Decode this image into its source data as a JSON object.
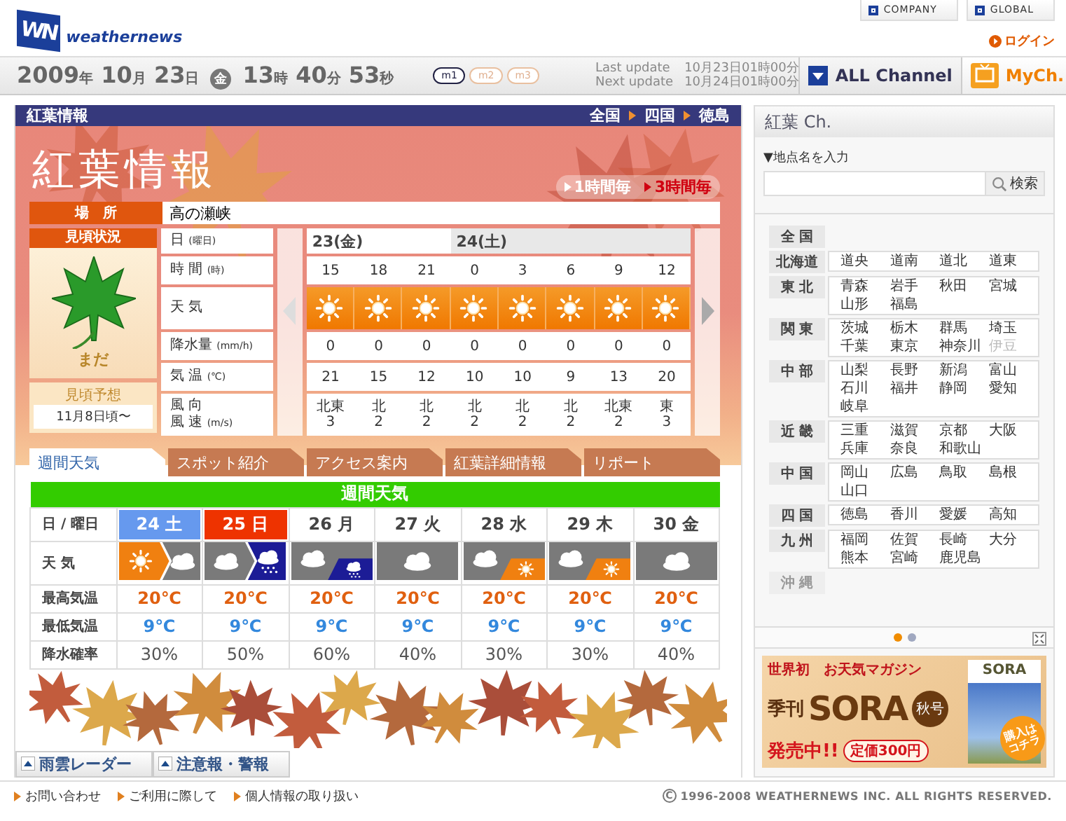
{
  "header": {
    "logo_mark": "WN",
    "logo": "weathernews",
    "links": [
      "COMPANY",
      "GLOBAL"
    ],
    "login": "ログイン"
  },
  "datebar": {
    "date": [
      {
        "value": "2009",
        "unit": "年"
      },
      {
        "value": "10",
        "unit": "月"
      },
      {
        "value": "23",
        "unit": "日"
      }
    ],
    "weekday": "金",
    "time": [
      {
        "value": "13",
        "unit": "時"
      },
      {
        "value": "40",
        "unit": "分"
      },
      {
        "value": "53",
        "unit": "秒"
      }
    ],
    "modes": [
      {
        "label": "m1",
        "selected": true
      },
      {
        "label": "m2",
        "selected": false
      },
      {
        "label": "m3",
        "selected": false
      }
    ],
    "updates": [
      {
        "label": "Last update",
        "value": "10月23日01時00分"
      },
      {
        "label": "Next update",
        "value": "10月24日01時00分"
      }
    ],
    "channels": [
      {
        "label": "ALL Channel",
        "kind": "all"
      },
      {
        "label": "MyCh.",
        "kind": "my"
      }
    ]
  },
  "panel": {
    "title": "紅葉情報",
    "breadcrumb": [
      "全国",
      "四国",
      "徳島"
    ],
    "heading": "紅葉情報",
    "intervals": [
      {
        "label": "1時間毎",
        "selected": false
      },
      {
        "label": "3時間毎",
        "selected": true
      }
    ],
    "place_label": "場　所",
    "place": "高の瀬峡",
    "status_label": "見頃状況",
    "status": "まだ",
    "forecast_label": "見頃予想",
    "forecast": "11月8日頃〜",
    "row_labels": [
      {
        "text": "日",
        "unit": "(曜日)"
      },
      {
        "text": "時 間",
        "unit": "(時)"
      },
      {
        "text": "天 気"
      },
      {
        "text": "降水量",
        "unit": "(mm/h)"
      },
      {
        "text": "気 温",
        "unit": "(℃)"
      },
      {
        "text": "風 向",
        "text2": "風 速",
        "unit": "(m/s)"
      }
    ],
    "days": [
      {
        "label": "23(金)",
        "shaded": false,
        "slots": [
          {
            "hour": "15",
            "weather": {
              "kind": "sunny"
            },
            "precip": "0",
            "temp": "21",
            "wind_dir": "北東",
            "wind_speed": "3"
          },
          {
            "hour": "18",
            "weather": {
              "kind": "sunny"
            },
            "precip": "0",
            "temp": "15",
            "wind_dir": "北",
            "wind_speed": "2"
          },
          {
            "hour": "21",
            "weather": {
              "kind": "sunny"
            },
            "precip": "0",
            "temp": "12",
            "wind_dir": "北",
            "wind_speed": "2"
          }
        ]
      },
      {
        "label": "24(土)",
        "shaded": true,
        "slots": [
          {
            "hour": "0",
            "weather": {
              "kind": "sunny"
            },
            "precip": "0",
            "temp": "10",
            "wind_dir": "北",
            "wind_speed": "2"
          },
          {
            "hour": "3",
            "weather": {
              "kind": "sunny"
            },
            "precip": "0",
            "temp": "10",
            "wind_dir": "北",
            "wind_speed": "2"
          },
          {
            "hour": "6",
            "weather": {
              "kind": "sunny"
            },
            "precip": "0",
            "temp": "9",
            "wind_dir": "北",
            "wind_speed": "2"
          },
          {
            "hour": "9",
            "weather": {
              "kind": "sunny"
            },
            "precip": "0",
            "temp": "13",
            "wind_dir": "北東",
            "wind_speed": "2"
          },
          {
            "hour": "12",
            "weather": {
              "kind": "sunny"
            },
            "precip": "0",
            "temp": "20",
            "wind_dir": "東",
            "wind_speed": "3"
          }
        ]
      }
    ],
    "tabs": [
      {
        "label": "週間天気",
        "selected": true
      },
      {
        "label": "スポット紹介",
        "selected": false
      },
      {
        "label": "アクセス案内",
        "selected": false
      },
      {
        "label": "紅葉詳細情報",
        "selected": false
      },
      {
        "label": "リポート",
        "selected": false
      }
    ],
    "weekly": {
      "title": "週間天気",
      "row_labels": [
        "日 / 曜日",
        "天 気",
        "最高気温",
        "最低気温",
        "降水確率"
      ],
      "days": [
        {
          "date": "24",
          "weekday": "土",
          "kind": "saturday",
          "weather": {
            "kind": "later",
            "parts": [
              {
                "kind": "sunny"
              },
              {
                "kind": "cloudy"
              }
            ]
          },
          "high": "20℃",
          "low": "9℃",
          "pop": "30%"
        },
        {
          "date": "25",
          "weekday": "日",
          "kind": "sunday",
          "weather": {
            "kind": "later",
            "parts": [
              {
                "kind": "cloudy"
              },
              {
                "kind": "rain"
              }
            ]
          },
          "high": "20℃",
          "low": "9℃",
          "pop": "50%"
        },
        {
          "date": "26",
          "weekday": "月",
          "kind": "weekday",
          "weather": {
            "kind": "sometimes",
            "parts": [
              {
                "kind": "cloudy"
              },
              {
                "kind": "rain"
              }
            ]
          },
          "high": "20℃",
          "low": "9℃",
          "pop": "60%"
        },
        {
          "date": "27",
          "weekday": "火",
          "kind": "weekday",
          "weather": {
            "kind": "single",
            "parts": [
              {
                "kind": "cloudy"
              }
            ]
          },
          "high": "20℃",
          "low": "9℃",
          "pop": "40%"
        },
        {
          "date": "28",
          "weekday": "水",
          "kind": "weekday",
          "weather": {
            "kind": "sometimes",
            "parts": [
              {
                "kind": "cloudy"
              },
              {
                "kind": "sunny"
              }
            ]
          },
          "high": "20℃",
          "low": "9℃",
          "pop": "30%"
        },
        {
          "date": "29",
          "weekday": "木",
          "kind": "weekday",
          "weather": {
            "kind": "sometimes",
            "parts": [
              {
                "kind": "cloudy"
              },
              {
                "kind": "sunny"
              }
            ]
          },
          "high": "20℃",
          "low": "9℃",
          "pop": "30%"
        },
        {
          "date": "30",
          "weekday": "金",
          "kind": "weekday",
          "weather": {
            "kind": "single",
            "parts": [
              {
                "kind": "cloudy"
              }
            ]
          },
          "high": "20℃",
          "low": "9℃",
          "pop": "40%"
        }
      ]
    },
    "bottom_links": [
      "雨雲レーダー",
      "注意報・警報"
    ]
  },
  "sidebar": {
    "title": "紅葉 Ch.",
    "search_label": "▼地点名を入力",
    "search_button": "検索",
    "regions": [
      {
        "name": "全 国",
        "disabled": false
      },
      {
        "name": "北海道",
        "disabled": false,
        "prefs": [
          {
            "name": "道央",
            "disabled": false
          },
          {
            "name": "道南",
            "disabled": false
          },
          {
            "name": "道北",
            "disabled": false
          },
          {
            "name": "道東",
            "disabled": false
          }
        ]
      },
      {
        "name": "東 北",
        "disabled": false,
        "prefs": [
          {
            "name": "青森",
            "disabled": false
          },
          {
            "name": "岩手",
            "disabled": false
          },
          {
            "name": "秋田",
            "disabled": false
          },
          {
            "name": "宮城",
            "disabled": false
          },
          {
            "name": "山形",
            "disabled": false
          },
          {
            "name": "福島",
            "disabled": false
          }
        ]
      },
      {
        "name": "関 東",
        "disabled": false,
        "prefs": [
          {
            "name": "茨城",
            "disabled": false
          },
          {
            "name": "栃木",
            "disabled": false
          },
          {
            "name": "群馬",
            "disabled": false
          },
          {
            "name": "埼玉",
            "disabled": false
          },
          {
            "name": "千葉",
            "disabled": false
          },
          {
            "name": "東京",
            "disabled": false
          },
          {
            "name": "神奈川",
            "disabled": false
          },
          {
            "name": "伊豆",
            "disabled": true
          }
        ]
      },
      {
        "name": "中 部",
        "disabled": false,
        "prefs": [
          {
            "name": "山梨",
            "disabled": false
          },
          {
            "name": "長野",
            "disabled": false
          },
          {
            "name": "新潟",
            "disabled": false
          },
          {
            "name": "富山",
            "disabled": false
          },
          {
            "name": "石川",
            "disabled": false
          },
          {
            "name": "福井",
            "disabled": false
          },
          {
            "name": "静岡",
            "disabled": false
          },
          {
            "name": "愛知",
            "disabled": false
          },
          {
            "name": "岐阜",
            "disabled": false
          }
        ]
      },
      {
        "name": "近 畿",
        "disabled": false,
        "prefs": [
          {
            "name": "三重",
            "disabled": false
          },
          {
            "name": "滋賀",
            "disabled": false
          },
          {
            "name": "京都",
            "disabled": false
          },
          {
            "name": "大阪",
            "disabled": false
          },
          {
            "name": "兵庫",
            "disabled": false
          },
          {
            "name": "奈良",
            "disabled": false
          },
          {
            "name": "和歌山",
            "disabled": false
          }
        ]
      },
      {
        "name": "中 国",
        "disabled": false,
        "prefs": [
          {
            "name": "岡山",
            "disabled": false
          },
          {
            "name": "広島",
            "disabled": false
          },
          {
            "name": "鳥取",
            "disabled": false
          },
          {
            "name": "島根",
            "disabled": false
          },
          {
            "name": "山口",
            "disabled": false
          }
        ]
      },
      {
        "name": "四 国",
        "disabled": false,
        "prefs": [
          {
            "name": "徳島",
            "disabled": false
          },
          {
            "name": "香川",
            "disabled": false
          },
          {
            "name": "愛媛",
            "disabled": false
          },
          {
            "name": "高知",
            "disabled": false
          }
        ]
      },
      {
        "name": "九 州",
        "disabled": false,
        "prefs": [
          {
            "name": "福岡",
            "disabled": false
          },
          {
            "name": "佐賀",
            "disabled": false
          },
          {
            "name": "長崎",
            "disabled": false
          },
          {
            "name": "大分",
            "disabled": false
          },
          {
            "name": "熊本",
            "disabled": false
          },
          {
            "name": "宮崎",
            "disabled": false
          },
          {
            "name": "鹿児島",
            "disabled": false
          }
        ]
      },
      {
        "name": "沖 縄",
        "disabled": true
      }
    ],
    "dots": [
      {
        "selected": true
      },
      {
        "selected": false
      }
    ],
    "ad": {
      "tagline": "世界初　お天気マガジン",
      "label": "季刊",
      "brand": "SORA",
      "season": "秋号",
      "sale": "発売中!!",
      "price": "定価300円",
      "cover_title": "SORA",
      "cta": "購入はコチラ"
    }
  },
  "footer": {
    "links": [
      "お問い合わせ",
      "ご利用に際して",
      "個人情報の取り扱い"
    ],
    "copyright_mark": "C",
    "copyright": "1996-2008 WEATHERNEWS INC. ALL RIGHTS RESERVED."
  }
}
